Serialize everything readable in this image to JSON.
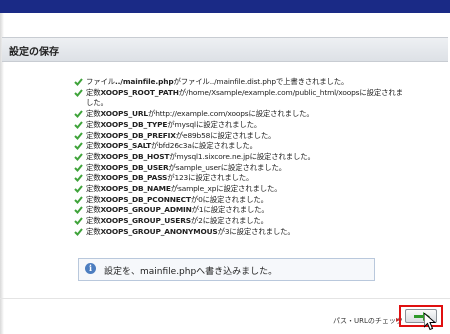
{
  "section": {
    "title": "設定の保存"
  },
  "messages": [
    {
      "a": "ファイル",
      "b": "../mainfile.php",
      "c": "がファイル",
      "d": "../mainfile.dist.php",
      "e": "で上書きされました。"
    },
    {
      "a": "定数",
      "b": "XOOPS_ROOT_PATH",
      "c": "が",
      "d": "/home/Xsample/example.com/public_html/xoops",
      "e": "に設定されました。"
    },
    {
      "a": "定数",
      "b": "XOOPS_URL",
      "c": "が",
      "d": "http://example.com/xoops",
      "e": "に設定されました。"
    },
    {
      "a": "定数",
      "b": "XOOPS_DB_TYPE",
      "c": "が",
      "d": "mysql",
      "e": "に設定されました。"
    },
    {
      "a": "定数",
      "b": "XOOPS_DB_PREFIX",
      "c": "が",
      "d": "e89b58",
      "e": "に設定されました。"
    },
    {
      "a": "定数",
      "b": "XOOPS_SALT",
      "c": "が",
      "d": "bfd26c3a",
      "e": "に設定されました。"
    },
    {
      "a": "定数",
      "b": "XOOPS_DB_HOST",
      "c": "が",
      "d": "mysql1.sixcore.ne.jp",
      "e": "に設定されました。"
    },
    {
      "a": "定数",
      "b": "XOOPS_DB_USER",
      "c": "が",
      "d": "sample_user",
      "e": "に設定されました。"
    },
    {
      "a": "定数",
      "b": "XOOPS_DB_PASS",
      "c": "が",
      "d": "123",
      "e": "に設定されました。"
    },
    {
      "a": "定数",
      "b": "XOOPS_DB_NAME",
      "c": "が",
      "d": "sample_xp",
      "e": "に設定されました。"
    },
    {
      "a": "定数",
      "b": "XOOPS_DB_PCONNECT",
      "c": "が",
      "d": "0",
      "e": "に設定されました。"
    },
    {
      "a": "定数",
      "b": "XOOPS_GROUP_ADMIN",
      "c": "が",
      "d": "1",
      "e": "に設定されました。"
    },
    {
      "a": "定数",
      "b": "XOOPS_GROUP_USERS",
      "c": "が",
      "d": "2",
      "e": "に設定されました。"
    },
    {
      "a": "定数",
      "b": "XOOPS_GROUP_ANONYMOUS",
      "c": "が",
      "d": "3",
      "e": "に設定されました。"
    }
  ],
  "info": {
    "text": "設定を、mainfile.phpへ書き込みました。",
    "icon": "info-icon"
  },
  "footer": {
    "next_label": "パス・URLのチェック",
    "next_arrow": "▸",
    "next_icon": "arrow-right-icon"
  },
  "colors": {
    "header_bar": "#1a2a86",
    "check": "#3fa33a",
    "highlight": "#e01010",
    "next_arrow": "#2f9a2a"
  }
}
